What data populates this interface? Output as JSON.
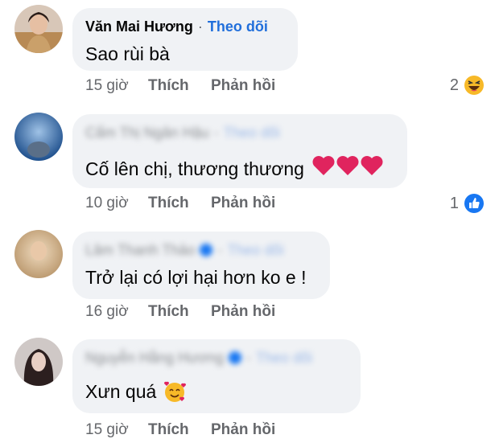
{
  "comments": [
    {
      "author": "Văn Mai Hương",
      "follow": "Theo dõi",
      "text": "Sao rùi bà",
      "time": "15 giờ",
      "like": "Thích",
      "reply": "Phản hồi",
      "reaction_count": "2",
      "reaction_icon": "haha-icon"
    },
    {
      "author": "Cẩm Thị Ngân Hậu",
      "follow": "Theo dõi",
      "text": "Cố lên chị, thương thương",
      "time": "10 giờ",
      "like": "Thích",
      "reply": "Phản hồi",
      "reaction_count": "1",
      "reaction_icon": "like-icon"
    },
    {
      "author": "Lâm Thanh Thảo",
      "follow": "Theo dõi",
      "text": "Trở lại có lợi hại hơn ko e !",
      "time": "16 giờ",
      "like": "Thích",
      "reply": "Phản hồi"
    },
    {
      "author": "Nguyễn Hằng Hương",
      "follow": "Theo dõi",
      "text": "Xưn quá",
      "time": "15 giờ",
      "like": "Thích",
      "reply": "Phản hồi"
    }
  ],
  "colors": {
    "bubble": "#f0f2f5",
    "link": "#216fdb",
    "heart": "#e0245e",
    "like_blue": "#1877f2"
  }
}
